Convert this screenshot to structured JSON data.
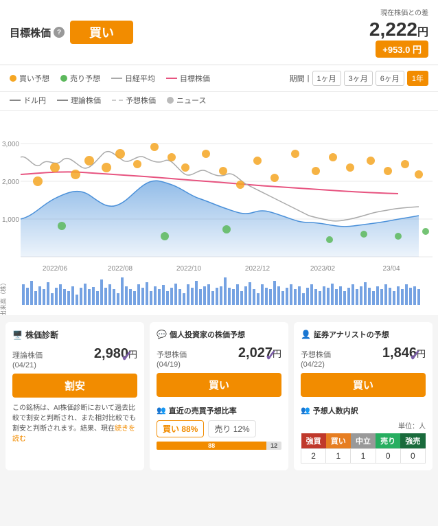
{
  "header": {
    "target_label": "目標株価",
    "help": "?",
    "buy_label": "買い",
    "current_diff_label": "現在株価との差",
    "price": "2,222",
    "price_yen": "円",
    "diff": "+953.0 円"
  },
  "legend": {
    "buy_predict": "買い予想",
    "sell_predict": "売り予想",
    "nikkei_avg": "日経平均",
    "target_price": "目標株価",
    "dollar_yen": "ドル円",
    "theory_price": "理論株価",
    "estimated_price": "予想株価",
    "news": "ニュース",
    "period_label": "期間",
    "periods": [
      "1ヶ月",
      "3ヶ月",
      "6ヶ月",
      "1年"
    ],
    "active_period": "1年"
  },
  "chart": {
    "y_labels": [
      "3,000",
      "2,000",
      "1,000"
    ],
    "x_labels": [
      "2022/06",
      "2022/08",
      "2022/10",
      "2022/12",
      "2023/02",
      "23/04"
    ]
  },
  "panels": {
    "stock_diagnosis": {
      "title": "株価診断",
      "theory_price_label": "理論株価",
      "date": "(04/21)",
      "price": "2,980",
      "price_yen": "円",
      "status": "割安",
      "description": "この銘柄は、AI株価診断において過去比較で割安と判断され、また相対比較でも割安と判断されます。結果、現在",
      "read_more": "続きを読む"
    },
    "individual_investor": {
      "title": "個人投資家の株価予想",
      "estimate_label": "予想株価",
      "date": "(04/19)",
      "price": "2,027",
      "price_yen": "円",
      "status": "買い",
      "checkmark": "✓",
      "sub_title": "直近の売買予想比率",
      "buy_label": "買い 88%",
      "sell_label": "売り 12%",
      "buy_pct": 88,
      "sell_pct": 12,
      "bar_buy_label": "88",
      "bar_sell_label": "12"
    },
    "analyst": {
      "title": "証券アナリストの予想",
      "estimate_label": "予想株価",
      "date": "(04/22)",
      "price": "1,846",
      "price_yen": "円",
      "status": "買い",
      "checkmark": "✓",
      "sub_title": "予想人数内訳",
      "unit": "単位：人",
      "table_headers": [
        "強買",
        "買い",
        "中立",
        "売り",
        "強売"
      ],
      "table_values": [
        "2",
        "1",
        "1",
        "0",
        "0"
      ]
    }
  }
}
